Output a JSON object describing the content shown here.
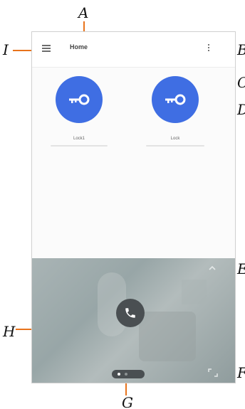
{
  "callouts": {
    "a": "A",
    "b": "B",
    "c": "C",
    "d": "D",
    "e": "E",
    "f": "F",
    "g": "G",
    "h": "H",
    "i": "I"
  },
  "appbar": {
    "title": "Home"
  },
  "locks": [
    {
      "name": "Lock1"
    },
    {
      "name": "Lock"
    }
  ],
  "colors": {
    "accent": "#3f6ee3",
    "callout_line": "#e8731c"
  },
  "icons": {
    "menu": "hamburger-menu-icon",
    "more": "vertical-dots-icon",
    "lock": "key-icon",
    "call": "phone-icon",
    "collapse": "chevron-up-icon",
    "expand": "fullscreen-icon"
  }
}
